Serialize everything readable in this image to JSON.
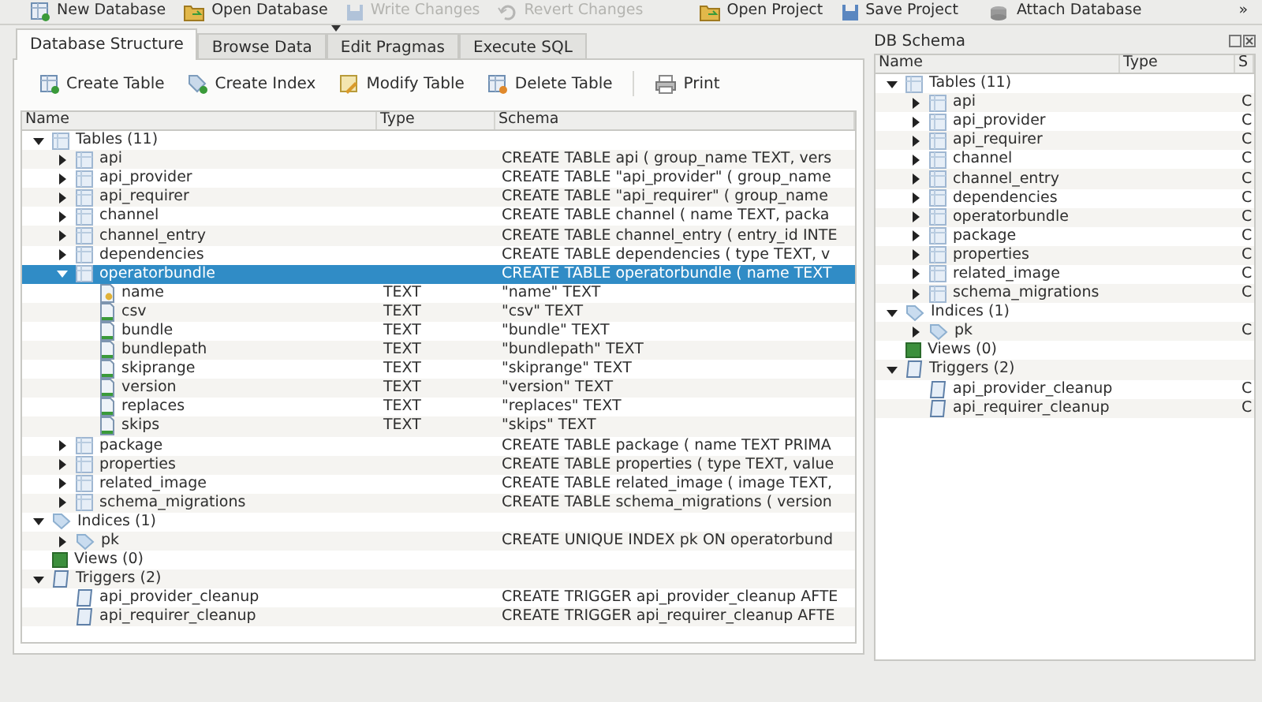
{
  "toolbar": [
    {
      "label": "New Database",
      "kind": "new_db",
      "disabled": false
    },
    {
      "label": "Open Database",
      "kind": "open_db",
      "disabled": false,
      "dropdown": true
    },
    {
      "label": "Write Changes",
      "kind": "write",
      "disabled": true
    },
    {
      "label": "Revert Changes",
      "kind": "revert",
      "disabled": true
    },
    {
      "label": "Open Project",
      "kind": "open_project",
      "disabled": false
    },
    {
      "label": "Save Project",
      "kind": "save_project",
      "disabled": false
    },
    {
      "label": "Attach Database",
      "kind": "attach",
      "disabled": false
    },
    {
      "label": "»",
      "kind": "more",
      "disabled": false
    }
  ],
  "tabs": [
    {
      "label": "Database Structure",
      "selected": true
    },
    {
      "label": "Browse Data",
      "selected": false
    },
    {
      "label": "Edit Pragmas",
      "selected": false
    },
    {
      "label": "Execute SQL",
      "selected": false
    }
  ],
  "actions": [
    {
      "label": "Create Table",
      "kind": "create_table"
    },
    {
      "label": "Create Index",
      "kind": "create_index"
    },
    {
      "label": "Modify Table",
      "kind": "modify_table"
    },
    {
      "label": "Delete Table",
      "kind": "delete_table"
    },
    {
      "label": "Print",
      "kind": "print"
    }
  ],
  "structure": {
    "columns": [
      "Name",
      "Type",
      "Schema"
    ],
    "tree": [
      {
        "name": "Tables (11)",
        "kind": "group_tables",
        "expanded": true,
        "selected": false,
        "children": [
          {
            "name": "api",
            "kind": "table",
            "expanded": false,
            "selected": false,
            "schema": "CREATE TABLE api ( group_name TEXT, vers"
          },
          {
            "name": "api_provider",
            "kind": "table",
            "expanded": false,
            "selected": false,
            "schema": "CREATE TABLE \"api_provider\" ( group_name"
          },
          {
            "name": "api_requirer",
            "kind": "table",
            "expanded": false,
            "selected": false,
            "schema": "CREATE TABLE \"api_requirer\" ( group_name"
          },
          {
            "name": "channel",
            "kind": "table",
            "expanded": false,
            "selected": false,
            "schema": "CREATE TABLE channel ( name TEXT, packa"
          },
          {
            "name": "channel_entry",
            "kind": "table",
            "expanded": false,
            "selected": false,
            "schema": "CREATE TABLE channel_entry ( entry_id INTE"
          },
          {
            "name": "dependencies",
            "kind": "table",
            "expanded": false,
            "selected": false,
            "schema": "CREATE TABLE dependencies ( type TEXT, v"
          },
          {
            "name": "operatorbundle",
            "kind": "table",
            "expanded": true,
            "selected": true,
            "schema": "CREATE TABLE operatorbundle ( name TEXT",
            "children": [
              {
                "name": "name",
                "kind": "key_field",
                "selected": false,
                "type": "TEXT",
                "schema": "\"name\" TEXT"
              },
              {
                "name": "csv",
                "kind": "field",
                "selected": false,
                "type": "TEXT",
                "schema": "\"csv\" TEXT"
              },
              {
                "name": "bundle",
                "kind": "field",
                "selected": false,
                "type": "TEXT",
                "schema": "\"bundle\" TEXT"
              },
              {
                "name": "bundlepath",
                "kind": "field",
                "selected": false,
                "type": "TEXT",
                "schema": "\"bundlepath\" TEXT"
              },
              {
                "name": "skiprange",
                "kind": "field",
                "selected": false,
                "type": "TEXT",
                "schema": "\"skiprange\" TEXT"
              },
              {
                "name": "version",
                "kind": "field",
                "selected": false,
                "type": "TEXT",
                "schema": "\"version\" TEXT"
              },
              {
                "name": "replaces",
                "kind": "field",
                "selected": false,
                "type": "TEXT",
                "schema": "\"replaces\" TEXT"
              },
              {
                "name": "skips",
                "kind": "field",
                "selected": false,
                "type": "TEXT",
                "schema": "\"skips\" TEXT"
              }
            ]
          },
          {
            "name": "package",
            "kind": "table",
            "expanded": false,
            "selected": false,
            "schema": "CREATE TABLE package ( name TEXT PRIMA"
          },
          {
            "name": "properties",
            "kind": "table",
            "expanded": false,
            "selected": false,
            "schema": "CREATE TABLE properties ( type TEXT, value"
          },
          {
            "name": "related_image",
            "kind": "table",
            "expanded": false,
            "selected": false,
            "schema": "CREATE TABLE related_image ( image TEXT,"
          },
          {
            "name": "schema_migrations",
            "kind": "table",
            "expanded": false,
            "selected": false,
            "schema": "CREATE TABLE schema_migrations ( version"
          }
        ]
      },
      {
        "name": "Indices (1)",
        "kind": "group_indices",
        "expanded": true,
        "selected": false,
        "children": [
          {
            "name": "pk",
            "kind": "index",
            "expanded": false,
            "selected": false,
            "schema": "CREATE UNIQUE INDEX pk ON operatorbund"
          }
        ]
      },
      {
        "name": "Views (0)",
        "kind": "group_views",
        "selected": false
      },
      {
        "name": "Triggers (2)",
        "kind": "group_triggers",
        "expanded": true,
        "selected": false,
        "children": [
          {
            "name": "api_provider_cleanup",
            "kind": "trigger",
            "selected": false,
            "schema": "CREATE TRIGGER api_provider_cleanup AFTE"
          },
          {
            "name": "api_requirer_cleanup",
            "kind": "trigger",
            "selected": false,
            "schema": "CREATE TRIGGER api_requirer_cleanup AFTE"
          }
        ]
      }
    ]
  },
  "schema_panel": {
    "title": "DB Schema",
    "columns": [
      "Name",
      "Type",
      "S"
    ],
    "tree": [
      {
        "name": "Tables (11)",
        "kind": "group_tables",
        "expanded": true,
        "selected": false,
        "children": [
          {
            "name": "api",
            "kind": "table",
            "expanded": false,
            "selected": false,
            "schema": "C"
          },
          {
            "name": "api_provider",
            "kind": "table",
            "expanded": false,
            "selected": false,
            "schema": "C"
          },
          {
            "name": "api_requirer",
            "kind": "table",
            "expanded": false,
            "selected": false,
            "schema": "C"
          },
          {
            "name": "channel",
            "kind": "table",
            "expanded": false,
            "selected": false,
            "schema": "C"
          },
          {
            "name": "channel_entry",
            "kind": "table",
            "expanded": false,
            "selected": false,
            "schema": "C"
          },
          {
            "name": "dependencies",
            "kind": "table",
            "expanded": false,
            "selected": false,
            "schema": "C"
          },
          {
            "name": "operatorbundle",
            "kind": "table",
            "expanded": false,
            "selected": false,
            "schema": "C"
          },
          {
            "name": "package",
            "kind": "table",
            "expanded": false,
            "selected": false,
            "schema": "C"
          },
          {
            "name": "properties",
            "kind": "table",
            "expanded": false,
            "selected": false,
            "schema": "C"
          },
          {
            "name": "related_image",
            "kind": "table",
            "expanded": false,
            "selected": false,
            "schema": "C"
          },
          {
            "name": "schema_migrations",
            "kind": "table",
            "expanded": false,
            "selected": false,
            "schema": "C"
          }
        ]
      },
      {
        "name": "Indices (1)",
        "kind": "group_indices",
        "expanded": true,
        "selected": false,
        "children": [
          {
            "name": "pk",
            "kind": "index",
            "expanded": false,
            "selected": false,
            "schema": "C"
          }
        ]
      },
      {
        "name": "Views (0)",
        "kind": "group_views",
        "selected": false
      },
      {
        "name": "Triggers (2)",
        "kind": "group_triggers",
        "expanded": true,
        "selected": false,
        "children": [
          {
            "name": "api_provider_cleanup",
            "kind": "trigger",
            "selected": false,
            "schema": "C"
          },
          {
            "name": "api_requirer_cleanup",
            "kind": "trigger",
            "selected": false,
            "schema": "C"
          }
        ]
      }
    ]
  }
}
